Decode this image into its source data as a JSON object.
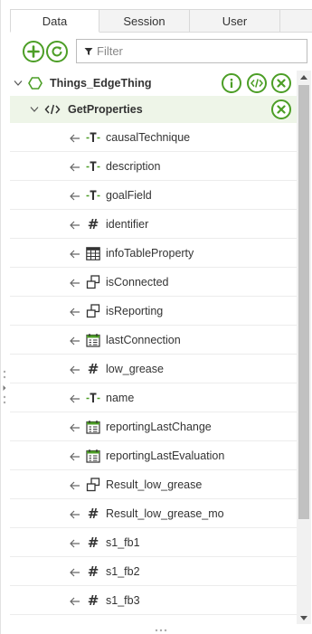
{
  "tabs": [
    {
      "label": "Data",
      "active": true
    },
    {
      "label": "Session",
      "active": false
    },
    {
      "label": "User",
      "active": false
    }
  ],
  "toolbar": {
    "add_icon": "plus-circle-icon",
    "refresh_icon": "refresh-circle-icon"
  },
  "filter": {
    "placeholder": "Filter",
    "value": ""
  },
  "thing": {
    "name": "Things_EdgeThing"
  },
  "service": {
    "name": "GetProperties"
  },
  "properties": [
    {
      "name": "causalTechnique",
      "type": "string"
    },
    {
      "name": "description",
      "type": "string"
    },
    {
      "name": "goalField",
      "type": "string"
    },
    {
      "name": "identifier",
      "type": "number"
    },
    {
      "name": "infoTableProperty",
      "type": "infotable"
    },
    {
      "name": "isConnected",
      "type": "boolean"
    },
    {
      "name": "isReporting",
      "type": "boolean"
    },
    {
      "name": "lastConnection",
      "type": "datetime"
    },
    {
      "name": "low_grease",
      "type": "number"
    },
    {
      "name": "name",
      "type": "string"
    },
    {
      "name": "reportingLastChange",
      "type": "datetime"
    },
    {
      "name": "reportingLastEvaluation",
      "type": "datetime"
    },
    {
      "name": "Result_low_grease",
      "type": "boolean"
    },
    {
      "name": "Result_low_grease_mo",
      "type": "number"
    },
    {
      "name": "s1_fb1",
      "type": "number"
    },
    {
      "name": "s1_fb2",
      "type": "number"
    },
    {
      "name": "s1_fb3",
      "type": "number"
    }
  ],
  "colors": {
    "accent": "#4c9e26",
    "service_bg": "#eef5e8"
  }
}
